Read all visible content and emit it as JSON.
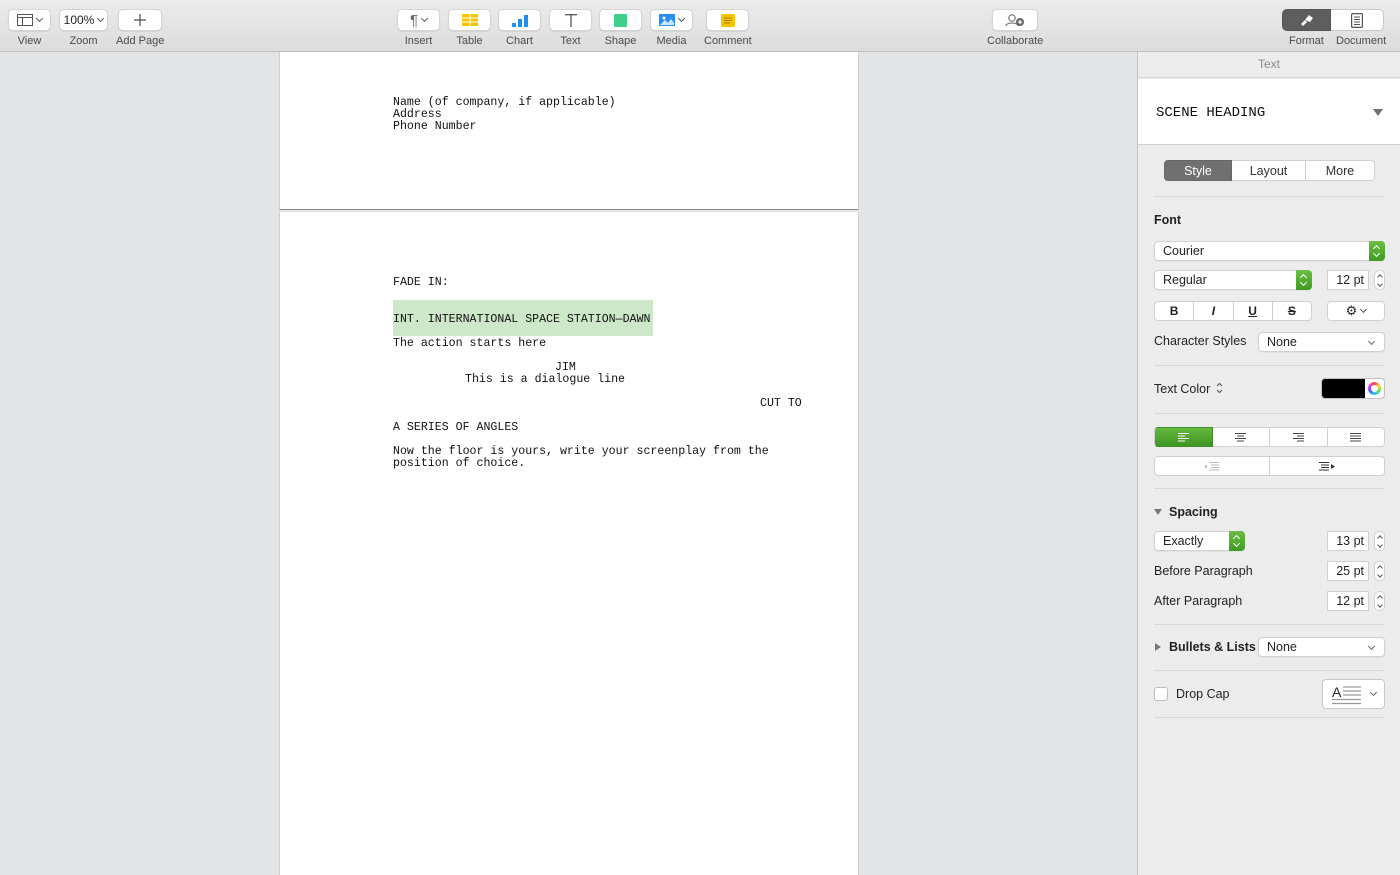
{
  "toolbar": {
    "view": {
      "label": "View",
      "icon": "sidebar-layout-icon"
    },
    "zoom": {
      "label": "Zoom",
      "value": "100%"
    },
    "add_page": {
      "label": "Add Page",
      "icon": "plus-icon"
    },
    "insert": {
      "label": "Insert",
      "icon": "pilcrow-icon"
    },
    "table": {
      "label": "Table",
      "icon": "table-icon",
      "color": "#f5c400"
    },
    "chart": {
      "label": "Chart",
      "icon": "bar-chart-icon",
      "color": "#1e8ff0"
    },
    "text": {
      "label": "Text",
      "icon": "text-icon"
    },
    "shape": {
      "label": "Shape",
      "icon": "square-icon",
      "color": "#3ed08a"
    },
    "media": {
      "label": "Media",
      "icon": "image-icon",
      "color": "#2a8ef2"
    },
    "comment": {
      "label": "Comment",
      "icon": "comment-icon",
      "color": "#f5c400"
    },
    "collaborate": {
      "label": "Collaborate",
      "icon": "add-person-icon"
    },
    "format": {
      "label": "Format",
      "icon": "paintbrush-icon",
      "active": true
    },
    "document": {
      "label": "Document",
      "icon": "document-icon"
    }
  },
  "document": {
    "page1_lines": [
      "Name (of company, if applicable)",
      "Address",
      "Phone Number"
    ],
    "fade_in": "FADE IN:",
    "scene_heading": "INT. INTERNATIONAL SPACE STATION—DAWN",
    "action": "The action starts here",
    "character": "JIM",
    "dialogue": "This is a dialogue line",
    "transition": "CUT TO",
    "shot": "A SERIES OF ANGLES",
    "action2_line1": "Now the floor is yours, write your screenplay from the",
    "action2_line2": "position of choice.",
    "highlight_color": "#cde8c8"
  },
  "sidebar": {
    "tab_title": "Text",
    "paragraph_style": "SCENE HEADING",
    "tabs": [
      {
        "label": "Style",
        "active": true
      },
      {
        "label": "Layout",
        "active": false
      },
      {
        "label": "More",
        "active": false
      }
    ],
    "font_section": "Font",
    "font_family": "Courier",
    "font_typeface": "Regular",
    "font_size": "12 pt",
    "format_buttons": [
      "B",
      "I",
      "U",
      "S"
    ],
    "character_styles_label": "Character Styles",
    "character_styles_value": "None",
    "text_color_label": "Text Color",
    "text_color": "#000000",
    "alignment": {
      "selected": "left",
      "options": [
        "left",
        "center",
        "right",
        "justify"
      ]
    },
    "spacing_section": "Spacing",
    "line_spacing_mode": "Exactly",
    "line_spacing_value": "13 pt",
    "before_paragraph_label": "Before Paragraph",
    "before_paragraph_value": "25 pt",
    "after_paragraph_label": "After Paragraph",
    "after_paragraph_value": "12 pt",
    "bullets_label": "Bullets & Lists",
    "bullets_value": "None",
    "drop_cap_label": "Drop Cap",
    "drop_cap_checked": false,
    "accent_color": "#4ea52e"
  }
}
